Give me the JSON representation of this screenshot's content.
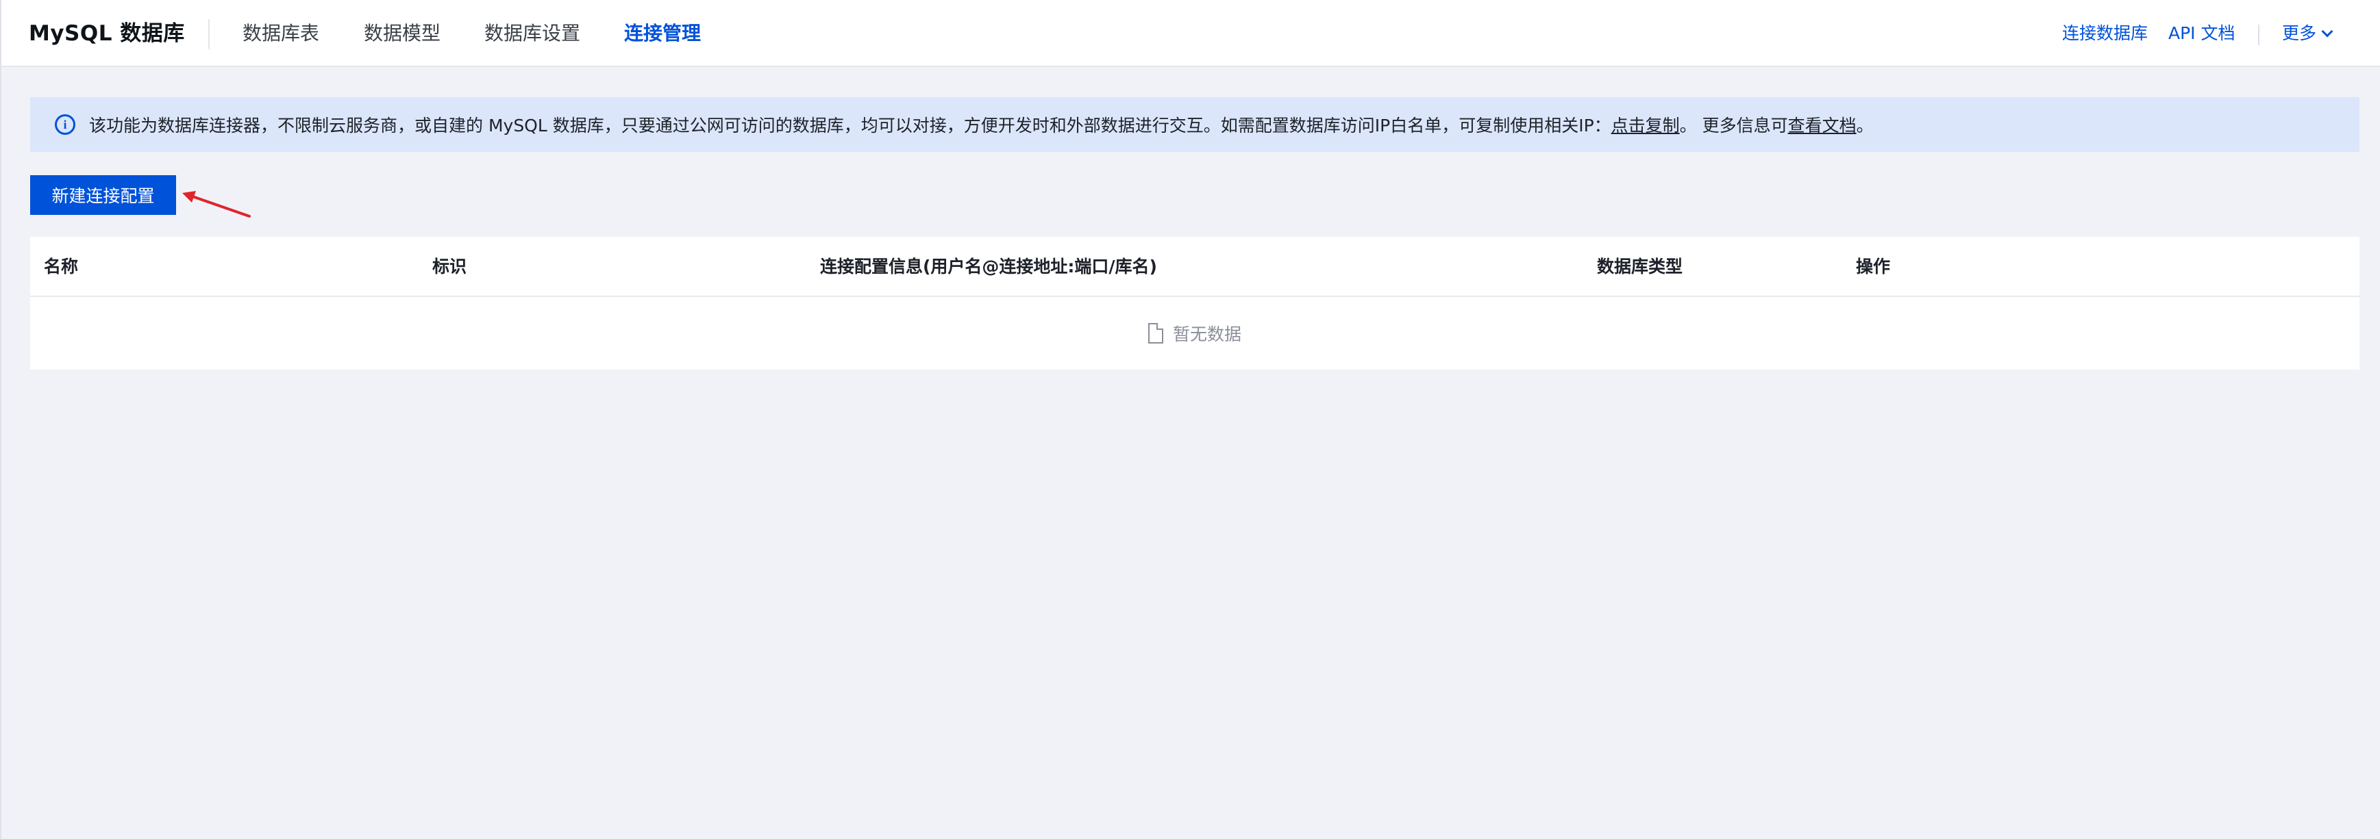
{
  "app": {
    "title": "MySQL 数据库"
  },
  "nav": {
    "tabs": [
      {
        "label": "数据库表"
      },
      {
        "label": "数据模型"
      },
      {
        "label": "数据库设置"
      },
      {
        "label": "连接管理",
        "active": true
      }
    ]
  },
  "top_right": {
    "connect_db": "连接数据库",
    "api_docs": "API 文档",
    "more": "更多"
  },
  "notice": {
    "text_before": "该功能为数据库连接器，不限制云服务商，或自建的 MySQL 数据库，只要通过公网可访问的数据库，均可以对接，方便开发时和外部数据进行交互。如需配置数据库访问IP白名单，可复制使用相关IP：",
    "copy_link": "点击复制",
    "text_middle": "。 更多信息可",
    "docs_link": "查看文档",
    "text_after": "。"
  },
  "actions": {
    "new_connection": "新建连接配置"
  },
  "table": {
    "columns": [
      "名称",
      "标识",
      "连接配置信息(用户名@连接地址:端口/库名)",
      "数据库类型",
      "操作"
    ],
    "empty_text": "暂无数据"
  },
  "colors": {
    "primary": "#0052d9",
    "notice_bg": "#dbe6fb",
    "page_bg": "#f0f2f7",
    "annotation_arrow": "#e0242b"
  },
  "icons": {
    "info": "info-circle-icon",
    "more_chevron": "chevron-down-icon",
    "empty": "document-icon",
    "annotation": "red-arrow-icon"
  }
}
